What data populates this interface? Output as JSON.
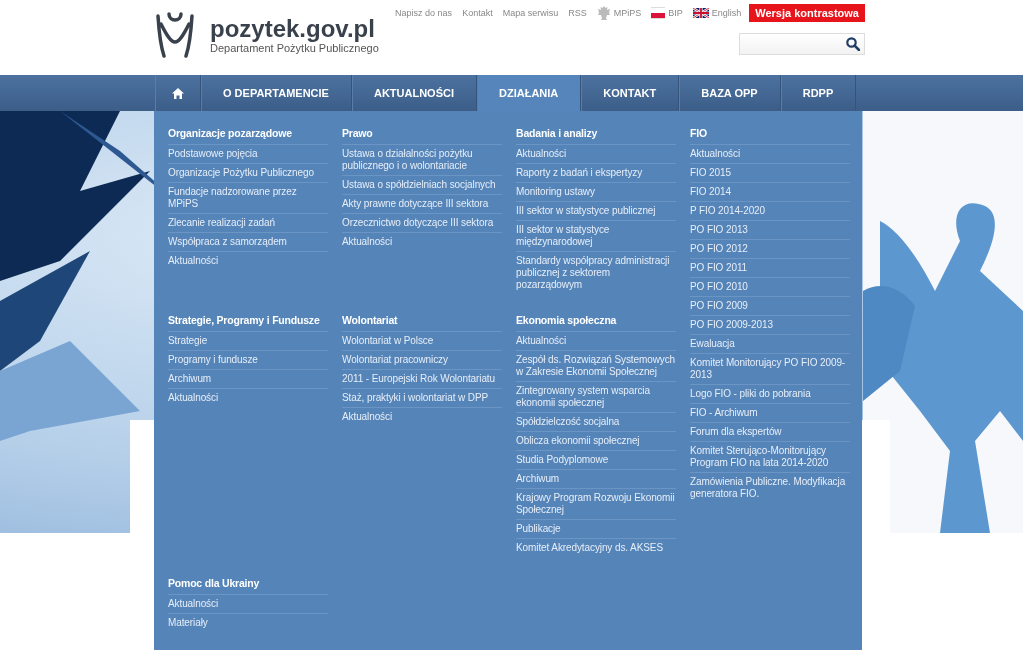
{
  "header": {
    "site_title": "pozytek.gov.pl",
    "subtitle": "Departament Pożytku Publicznego",
    "top_links": [
      {
        "label": "Napisz do nas",
        "kind": "text"
      },
      {
        "label": "Kontakt",
        "kind": "text"
      },
      {
        "label": "Mapa serwisu",
        "kind": "text"
      },
      {
        "label": "RSS",
        "kind": "text"
      },
      {
        "label": "MPiPS",
        "kind": "emblem"
      },
      {
        "label": "BIP",
        "kind": "flag-pl"
      },
      {
        "label": "English",
        "kind": "flag-uk"
      }
    ],
    "contrast_button": "Wersja kontrastowa"
  },
  "nav": [
    {
      "kind": "home",
      "selected": false
    },
    {
      "kind": "text",
      "label": "O DEPARTAMENCIE",
      "selected": false
    },
    {
      "kind": "text",
      "label": "AKTUALNOŚCI",
      "selected": false
    },
    {
      "kind": "text",
      "label": "DZIAŁANIA",
      "selected": true
    },
    {
      "kind": "text",
      "label": "KONTAKT",
      "selected": false
    },
    {
      "kind": "text",
      "label": "BAZA OPP",
      "selected": false
    },
    {
      "kind": "text",
      "label": "RDPP",
      "selected": false
    }
  ],
  "menu_columns": [
    {
      "groups": [
        {
          "heading": "Organizacje pozarządowe",
          "items": [
            "Podstawowe pojęcia",
            "Organizacje Pożytku Publicznego",
            "Fundacje nadzorowane przez MPiPS",
            "Zlecanie realizacji zadań",
            "Współpraca z samorządem",
            "Aktualności"
          ]
        },
        {
          "heading": "Strategie, Programy i Fundusze",
          "items": [
            "Strategie",
            "Programy i fundusze",
            "Archiwum",
            "Aktualności"
          ]
        },
        {
          "heading": "Pomoc dla Ukrainy",
          "items": [
            "Aktualności",
            "Materiały"
          ]
        }
      ]
    },
    {
      "groups": [
        {
          "heading": "Prawo",
          "items": [
            "Ustawa o działalności pożytku publicznego i o wolontariacie",
            "Ustawa o spółdzielniach socjalnych",
            "Akty prawne dotyczące III sektora",
            "Orzecznictwo dotyczące III sektora",
            "Aktualności"
          ]
        },
        {
          "heading": "Wolontariat",
          "items": [
            "Wolontariat w Polsce",
            "Wolontariat pracowniczy",
            "2011 - Europejski Rok Wolontariatu",
            "Staż, praktyki i wolontariat w DPP",
            "Aktualności"
          ]
        }
      ]
    },
    {
      "groups": [
        {
          "heading": "Badania i analizy",
          "items": [
            "Aktualności",
            "Raporty z badań i ekspertyzy",
            "Monitoring ustawy",
            "III sektor w statystyce publicznej",
            "III sektor w statystyce międzynarodowej",
            "Standardy współpracy administracji publicznej z sektorem pozarządowym"
          ]
        },
        {
          "heading": "Ekonomia społeczna",
          "items": [
            "Aktualności",
            "Zespół ds. Rozwiązań Systemowych w Zakresie Ekonomii Społecznej",
            "Zintegrowany system wsparcia ekonomii społecznej",
            "Spółdzielczość socjalna",
            "Oblicza ekonomii społecznej",
            "Studia Podyplomowe",
            "Archiwum",
            "Krajowy Program Rozwoju Ekonomii Społecznej",
            "Publikacje",
            "Komitet Akredytacyjny ds. AKSES"
          ]
        }
      ]
    },
    {
      "groups": [
        {
          "heading": "FIO",
          "items": [
            "Aktualności",
            "FIO 2015",
            "FIO 2014",
            "P FIO 2014-2020",
            "PO FIO 2013",
            "PO FIO 2012",
            "PO FIO 2011",
            "PO FIO 2010",
            "PO FIO 2009",
            "PO FIO 2009-2013",
            "Ewaluacja",
            "Komitet Monitorujący PO FIO 2009-2013",
            "Logo FIO - pliki do pobrania",
            "FIO - Archiwum",
            "Forum dla ekspertów",
            "Komitet Sterująco-Monitorujący Program FIO na lata 2014-2020",
            "Zamówienia Publiczne. Modyfikacja generatora FIO."
          ]
        }
      ]
    }
  ]
}
